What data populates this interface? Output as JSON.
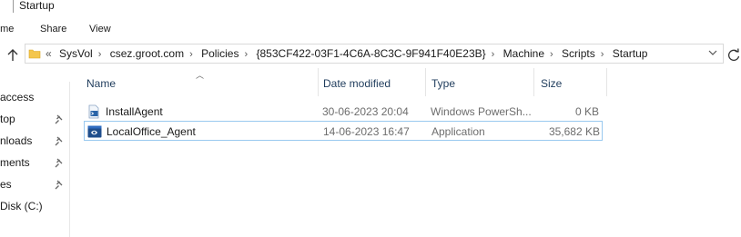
{
  "window": {
    "title": "Startup"
  },
  "ribbon": {
    "tabs": [
      "ome",
      "Share",
      "View"
    ]
  },
  "address": {
    "breadcrumbs": [
      "SysVol",
      "csez.groot.com",
      "Policies",
      "{853CF422-03F1-4C6A-8C3C-9F941F40E23B}",
      "Machine",
      "Scripts",
      "Startup"
    ]
  },
  "navpane": {
    "items": [
      {
        "label": "access",
        "pinned": false
      },
      {
        "label": "top",
        "pinned": true
      },
      {
        "label": "nloads",
        "pinned": true
      },
      {
        "label": "ments",
        "pinned": true
      },
      {
        "label": "es",
        "pinned": true
      },
      {
        "label": " Disk (C:)",
        "pinned": false
      }
    ]
  },
  "filelist": {
    "columns": {
      "name": "Name",
      "date": "Date modified",
      "type": "Type",
      "size": "Size"
    },
    "rows": [
      {
        "name": "InstallAgent",
        "date": "30-06-2023 20:04",
        "type": "Windows PowerSh...",
        "size": "0 KB",
        "icon": "powershell-script-icon",
        "selected": false
      },
      {
        "name": "LocalOffice_Agent",
        "date": "14-06-2023 16:47",
        "type": "Application",
        "size": "35,682 KB",
        "icon": "application-icon",
        "selected": true
      }
    ]
  }
}
